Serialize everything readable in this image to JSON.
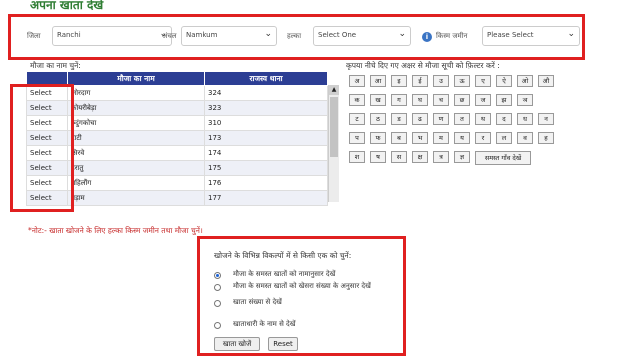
{
  "page": {
    "title": "अपना खाता देखें"
  },
  "filters": [
    {
      "label": "जिला",
      "value": "Ranchi"
    },
    {
      "label": "अंचल",
      "value": "Namkum"
    },
    {
      "label": "हल्का",
      "value": "Select One"
    },
    {
      "label": "किस्म जमीन",
      "value": "Please Select"
    }
  ],
  "mouza": {
    "prompt": "मौजा का नाम चुनें:",
    "headers": [
      "",
      "मौजा का नाम",
      "राजस्व थाना"
    ],
    "select_label": "Select",
    "rows": [
      {
        "name": "जोरदाग",
        "thana": "324"
      },
      {
        "name": "कोयरीबेड़ा",
        "thana": "323"
      },
      {
        "name": "रुदुंगकोचा",
        "thana": "310"
      },
      {
        "name": "टाटी",
        "thana": "173"
      },
      {
        "name": "सिरवे",
        "thana": "174"
      },
      {
        "name": "हरातु",
        "thana": "175"
      },
      {
        "name": "महिलौंग",
        "thana": "176"
      },
      {
        "name": "बड़ाम",
        "thana": "177"
      }
    ]
  },
  "alphabet": {
    "prompt": "कृपया नीचे दिए गए अक्षर से मौजा सूची को फ़िल्टर करें :",
    "rows": [
      [
        "अ",
        "आ",
        "इ",
        "ई",
        "उ",
        "ऊ",
        "ए",
        "ऐ",
        "ओ",
        "औ"
      ],
      [
        "क",
        "ख",
        "ग",
        "घ",
        "च",
        "छ",
        "ज",
        "झ",
        "ञ"
      ],
      [
        "ट",
        "ठ",
        "ड",
        "ढ",
        "ण",
        "त",
        "थ",
        "द",
        "ध",
        "न"
      ],
      [
        "प",
        "फ",
        "ब",
        "भ",
        "म",
        "य",
        "र",
        "ल",
        "व",
        "ह"
      ],
      [
        "श",
        "ष",
        "स",
        "क्ष",
        "त्र",
        "ज्ञ"
      ]
    ],
    "all_button": "समस्त गाँव देखें"
  },
  "note": "*नोट:- खाता खोजने के लिए हल्का किस्म जमीन तथा मौजा चुनें।",
  "search": {
    "prompt": "खोजने के विभिन्न विकल्पों में से किसी एक को चुनें:",
    "options": [
      "मौजा के समस्त खातों को नामानुसार देखें",
      "मौजा के समस्त खातों को खेसरा संख्या के अनुसार देखें",
      "खाता संख्या से देखें",
      "खाताधारी के नाम से देखें"
    ],
    "submit": "खाता खोजें",
    "reset": "Reset"
  }
}
